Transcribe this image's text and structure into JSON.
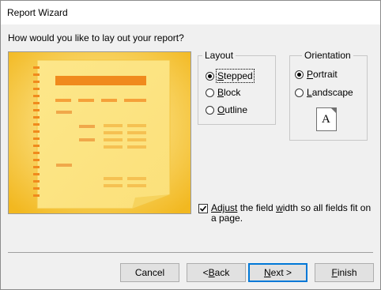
{
  "window": {
    "title": "Report Wizard"
  },
  "question": "How would you like to lay out your report?",
  "layout": {
    "label": "Layout",
    "options": [
      {
        "pre": "",
        "accel": "S",
        "post": "tepped",
        "selected": true
      },
      {
        "pre": "",
        "accel": "B",
        "post": "lock",
        "selected": false
      },
      {
        "pre": "",
        "accel": "O",
        "post": "utline",
        "selected": false
      }
    ]
  },
  "orientation": {
    "label": "Orientation",
    "options": [
      {
        "pre": "",
        "accel": "P",
        "post": "ortrait",
        "selected": true
      },
      {
        "pre": "",
        "accel": "L",
        "post": "andscape",
        "selected": false
      }
    ],
    "preview_letter": "A"
  },
  "adjust": {
    "checked": true,
    "accel": "Adjust",
    "line1_mid": " the field ",
    "line1_accel2": "w",
    "line1_rest": "idth so all fields fit on",
    "line2": "a page."
  },
  "buttons": {
    "cancel": "Cancel",
    "back_pre": "< ",
    "back_accel": "B",
    "back_post": "ack",
    "next_pre": "",
    "next_accel": "N",
    "next_post": "ext >",
    "finish_pre": "",
    "finish_accel": "F",
    "finish_post": "inish"
  },
  "colors": {
    "preview_bg": "#f5c531",
    "default_button_border": "#0078d7"
  }
}
